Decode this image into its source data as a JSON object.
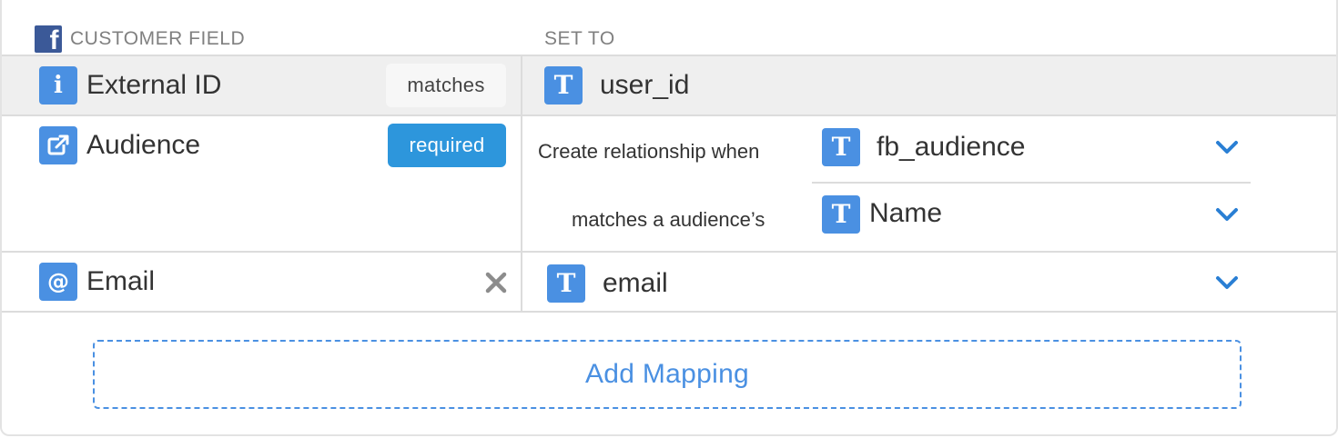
{
  "header": {
    "brand_icon": "facebook-logo-icon",
    "customer_field_label": "CUSTOMER FIELD",
    "set_to_label": "SET TO"
  },
  "rows": [
    {
      "field_icon": "info-icon",
      "field_label": "External ID",
      "badge": "matches",
      "value_icon": "text-type-icon",
      "value": "user_id"
    },
    {
      "field_icon": "external-link-icon",
      "field_label": "Audience",
      "badge": "required",
      "create_relationship_label": "Create relationship when",
      "relationship_value": "fb_audience",
      "matches_label": "matches a audience’s",
      "match_value": "Name"
    },
    {
      "field_icon": "at-sign-icon",
      "field_label": "Email",
      "value_icon": "text-type-icon",
      "value": "email"
    }
  ],
  "add_mapping_label": "Add Mapping",
  "colors": {
    "accent": "#4a90e2",
    "required_badge": "#2d96dc",
    "facebook": "#3b5998",
    "highlight_row": "#efefef"
  }
}
